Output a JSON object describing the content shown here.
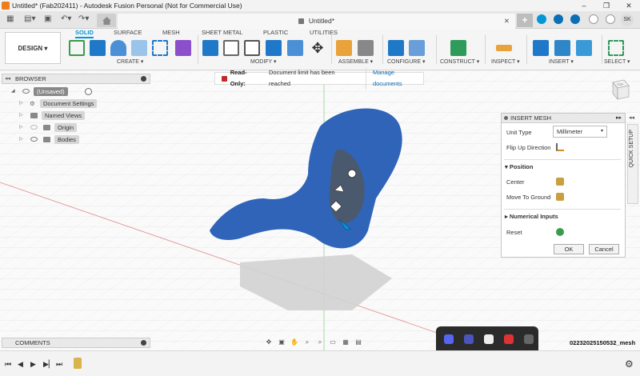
{
  "window": {
    "title": "Untitled* (Fab202411) - Autodesk Fusion Personal (Not for Commercial Use)",
    "controls": [
      "–",
      "❐",
      "✕"
    ]
  },
  "tabs": {
    "document_title": "Untitled*",
    "close_glyph": "✕",
    "new_tab_glyph": "+",
    "user_initials": "SK"
  },
  "toolbar": {
    "workspace_button": "DESIGN",
    "workspace_tabs": [
      {
        "label": "SOLID",
        "active": true
      },
      {
        "label": "SURFACE"
      },
      {
        "label": "MESH"
      },
      {
        "label": "SHEET METAL"
      },
      {
        "label": "PLASTIC"
      },
      {
        "label": "UTILITIES"
      }
    ],
    "groups": [
      "CREATE ▾",
      "MODIFY ▾",
      "ASSEMBLE ▾",
      "CONFIGURE ▾",
      "CONSTRUCT ▾",
      "INSPECT ▾",
      "INSERT ▾",
      "SELECT ▾"
    ]
  },
  "browser": {
    "title": "BROWSER",
    "items": [
      {
        "label": "(Unsaved)"
      },
      {
        "label": "Document Settings"
      },
      {
        "label": "Named Views"
      },
      {
        "label": "Origin"
      },
      {
        "label": "Bodies"
      }
    ]
  },
  "notice": {
    "bold": "Read-Only:",
    "text": "Document limit has been reached",
    "link": "Manage documents"
  },
  "viewcube": {
    "face": "TOP"
  },
  "insert_mesh": {
    "title": "INSERT MESH",
    "unit_type_label": "Unit Type",
    "unit_type_value": "Millimeter",
    "flip_label": "Flip Up Direction",
    "position_section": "Position",
    "center_label": "Center",
    "move_to_ground_label": "Move To Ground",
    "numerical_section": "Numerical Inputs",
    "reset_label": "Reset",
    "ok": "OK",
    "cancel": "Cancel"
  },
  "quick_setup": "QUICK SETUP",
  "comments": {
    "title": "COMMENTS"
  },
  "file_label": "02232025150532_mesh",
  "colors": {
    "accent": "#0696d7",
    "mesh": "#2f64b8",
    "panel_bg": "#ffffff"
  }
}
